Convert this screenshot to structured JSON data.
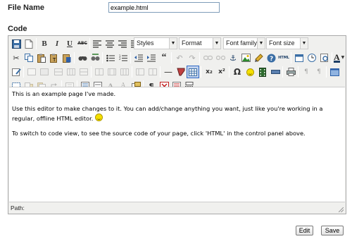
{
  "form": {
    "filename_label": "File Name",
    "filename_value": "example.html",
    "code_label": "Code"
  },
  "toolbar": {
    "styles_combo": "Styles",
    "format_combo": "Format",
    "fontfamily_combo": "Font family",
    "fontsize_combo": "Font size",
    "bold": "B",
    "italic": "I",
    "underline": "U",
    "strike": "ABC",
    "blockquote": "“",
    "hr": "—",
    "subscript": "x₂",
    "superscript": "x²",
    "omega": "Ω",
    "pilcrow": "¶",
    "font_color_letter": "A",
    "a_large": "A",
    "a_small": "A",
    "html_button": "HTML"
  },
  "content": {
    "p1": "This is an example page I've made.",
    "p2": "Use this editor to make changes to it. You can add/change anything you want, just like you're working in a regular, offline HTML editor.",
    "p3": "To switch to code view, to see the source code of your page, click 'HTML' in the control panel above."
  },
  "status": {
    "path_label": "Path:"
  },
  "actions": {
    "edit": "Edit",
    "save": "Save"
  },
  "colors": {
    "toolbar_bg": "#f0f0ee",
    "border": "#a9a9a9",
    "input_border": "#7f9db9",
    "smiley": "#f5e000"
  }
}
